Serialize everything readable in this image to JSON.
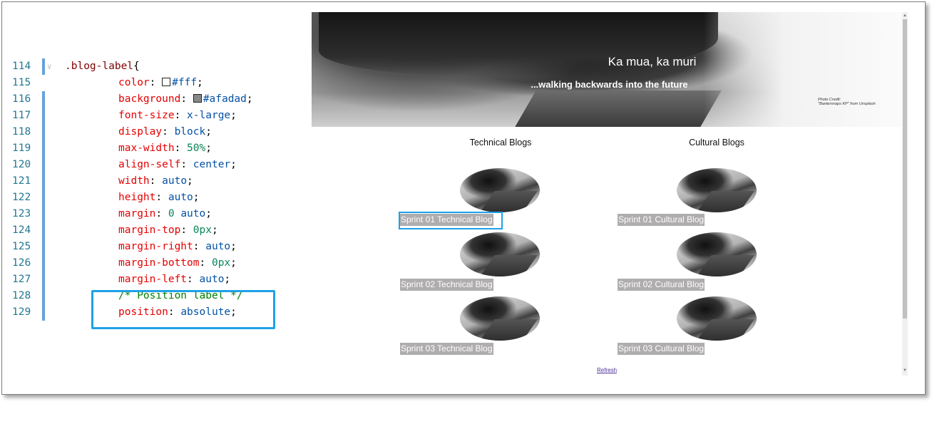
{
  "editor": {
    "lines": [
      {
        "n": "114",
        "tokens": [
          {
            "t": ".blog-label",
            "c": "sel"
          },
          {
            "t": "{",
            "c": "punc"
          }
        ],
        "indent": 0
      },
      {
        "n": "115",
        "tokens": [
          {
            "t": "color",
            "c": "prop"
          },
          {
            "t": ": ",
            "c": "punc"
          },
          {
            "t": "SWATCH_fff",
            "c": "swatch"
          },
          {
            "t": "#fff",
            "c": "val"
          },
          {
            "t": ";",
            "c": "punc"
          }
        ],
        "indent": 1
      },
      {
        "n": "116",
        "tokens": [
          {
            "t": "background",
            "c": "prop"
          },
          {
            "t": ": ",
            "c": "punc"
          },
          {
            "t": "SWATCH_afadad",
            "c": "swatch"
          },
          {
            "t": "#afadad",
            "c": "val"
          },
          {
            "t": ";",
            "c": "punc"
          }
        ],
        "indent": 1
      },
      {
        "n": "117",
        "tokens": [
          {
            "t": "font-size",
            "c": "prop"
          },
          {
            "t": ": ",
            "c": "punc"
          },
          {
            "t": "x-large",
            "c": "val"
          },
          {
            "t": ";",
            "c": "punc"
          }
        ],
        "indent": 1
      },
      {
        "n": "118",
        "tokens": [
          {
            "t": "display",
            "c": "prop"
          },
          {
            "t": ": ",
            "c": "punc"
          },
          {
            "t": "block",
            "c": "val"
          },
          {
            "t": ";",
            "c": "punc"
          }
        ],
        "indent": 1
      },
      {
        "n": "119",
        "tokens": [
          {
            "t": "max-width",
            "c": "prop"
          },
          {
            "t": ": ",
            "c": "punc"
          },
          {
            "t": "50%",
            "c": "num"
          },
          {
            "t": ";",
            "c": "punc"
          }
        ],
        "indent": 1
      },
      {
        "n": "120",
        "tokens": [
          {
            "t": "align-self",
            "c": "prop"
          },
          {
            "t": ": ",
            "c": "punc"
          },
          {
            "t": "center",
            "c": "val"
          },
          {
            "t": ";",
            "c": "punc"
          }
        ],
        "indent": 1
      },
      {
        "n": "121",
        "tokens": [
          {
            "t": "width",
            "c": "prop"
          },
          {
            "t": ": ",
            "c": "punc"
          },
          {
            "t": "auto",
            "c": "val"
          },
          {
            "t": ";",
            "c": "punc"
          }
        ],
        "indent": 1
      },
      {
        "n": "122",
        "tokens": [
          {
            "t": "height",
            "c": "prop"
          },
          {
            "t": ": ",
            "c": "punc"
          },
          {
            "t": "auto",
            "c": "val"
          },
          {
            "t": ";",
            "c": "punc"
          }
        ],
        "indent": 1
      },
      {
        "n": "123",
        "tokens": [
          {
            "t": "margin",
            "c": "prop"
          },
          {
            "t": ": ",
            "c": "punc"
          },
          {
            "t": "0",
            "c": "num"
          },
          {
            "t": " ",
            "c": "punc"
          },
          {
            "t": "auto",
            "c": "val"
          },
          {
            "t": ";",
            "c": "punc"
          }
        ],
        "indent": 1
      },
      {
        "n": "124",
        "tokens": [
          {
            "t": "margin-top",
            "c": "prop"
          },
          {
            "t": ": ",
            "c": "punc"
          },
          {
            "t": "0px",
            "c": "num"
          },
          {
            "t": ";",
            "c": "punc"
          }
        ],
        "indent": 1
      },
      {
        "n": "125",
        "tokens": [
          {
            "t": "margin-right",
            "c": "prop"
          },
          {
            "t": ": ",
            "c": "punc"
          },
          {
            "t": "auto",
            "c": "val"
          },
          {
            "t": ";",
            "c": "punc"
          }
        ],
        "indent": 1
      },
      {
        "n": "126",
        "tokens": [
          {
            "t": "margin-bottom",
            "c": "prop"
          },
          {
            "t": ": ",
            "c": "punc"
          },
          {
            "t": "0px",
            "c": "num"
          },
          {
            "t": ";",
            "c": "punc"
          }
        ],
        "indent": 1
      },
      {
        "n": "127",
        "tokens": [
          {
            "t": "margin-left",
            "c": "prop"
          },
          {
            "t": ": ",
            "c": "punc"
          },
          {
            "t": "auto",
            "c": "val"
          },
          {
            "t": ";",
            "c": "punc"
          }
        ],
        "indent": 1
      },
      {
        "n": "128",
        "tokens": [
          {
            "t": "/* Position label */",
            "c": "cmt"
          }
        ],
        "indent": 1
      },
      {
        "n": "129",
        "tokens": [
          {
            "t": "position",
            "c": "prop"
          },
          {
            "t": ": ",
            "c": "punc"
          },
          {
            "t": "absolute",
            "c": "val"
          },
          {
            "t": ";",
            "c": "punc"
          }
        ],
        "indent": 1
      }
    ],
    "swatch_colors": {
      "SWATCH_fff": "#ffffff",
      "SWATCH_afadad": "#888888"
    }
  },
  "preview": {
    "hero": {
      "title": "Ka mua, ka muri",
      "subtitle": "...walking backwards into the future",
      "credit_line1": "Photo Credit:",
      "credit_line2": "\"Bantersnaps KP\" from Unsplash"
    },
    "columns": [
      {
        "title": "Technical Blogs",
        "labels": [
          "Sprint 01 Technical Blog",
          "Sprint 02 Technical Blog",
          "Sprint 03 Technical Blog"
        ]
      },
      {
        "title": "Cultural Blogs",
        "labels": [
          "Sprint 01 Cultural Blog",
          "Sprint 02 Cultural Blog",
          "Sprint 03 Cultural Blog"
        ]
      }
    ],
    "refresh": "Refresh"
  },
  "colors": {
    "label_bg": "#afadad",
    "label_text": "#ffffff",
    "highlight": "#1ea1e8"
  }
}
